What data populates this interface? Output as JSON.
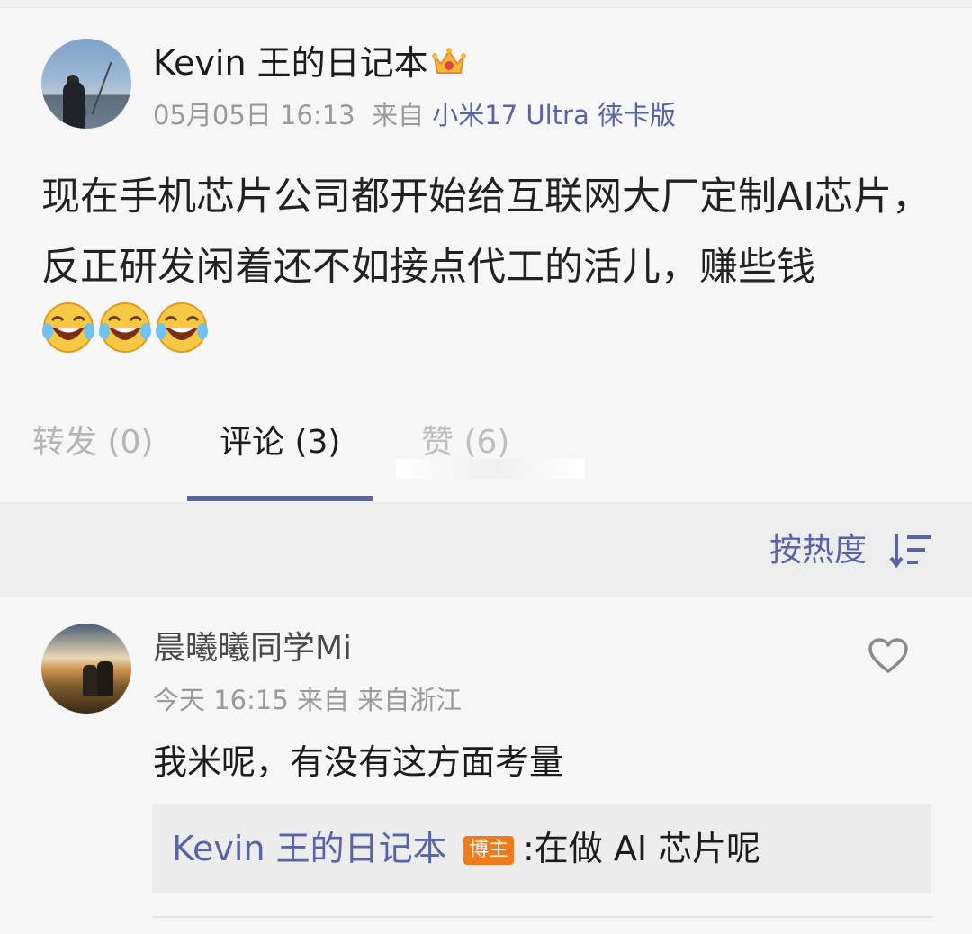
{
  "post": {
    "author": "Kevin 王的日记本",
    "time": "05月05日 16:13",
    "from_label": "来自",
    "source": "小米17 Ultra 徕卡版",
    "content": "现在手机芯片公司都开始给互联网大厂定制AI芯片，反正研发闲着还不如接点代工的活儿，赚些钱",
    "emojis": [
      "laugh-cry-emoji",
      "laugh-cry-emoji",
      "laugh-cry-emoji"
    ],
    "badge_icon": "crown-icon"
  },
  "tabs": {
    "repost": "转发 (0)",
    "comment": "评论 (3)",
    "like": "赞 (6)"
  },
  "sort": {
    "label": "按热度",
    "icon": "sort-descending-icon"
  },
  "comment": {
    "author": "晨曦曦同学Mi",
    "time": "今天 16:15",
    "from_label": "来自",
    "location": "来自浙江",
    "text": "我米呢，有没有这方面考量",
    "reply": {
      "author": "Kevin 王的日记本",
      "badge": "博主",
      "text": ":在做 AI 芯片呢"
    }
  },
  "colors": {
    "accent": "#5b63a7",
    "badge": "#f07b1c",
    "muted": "#9a9a9a"
  }
}
